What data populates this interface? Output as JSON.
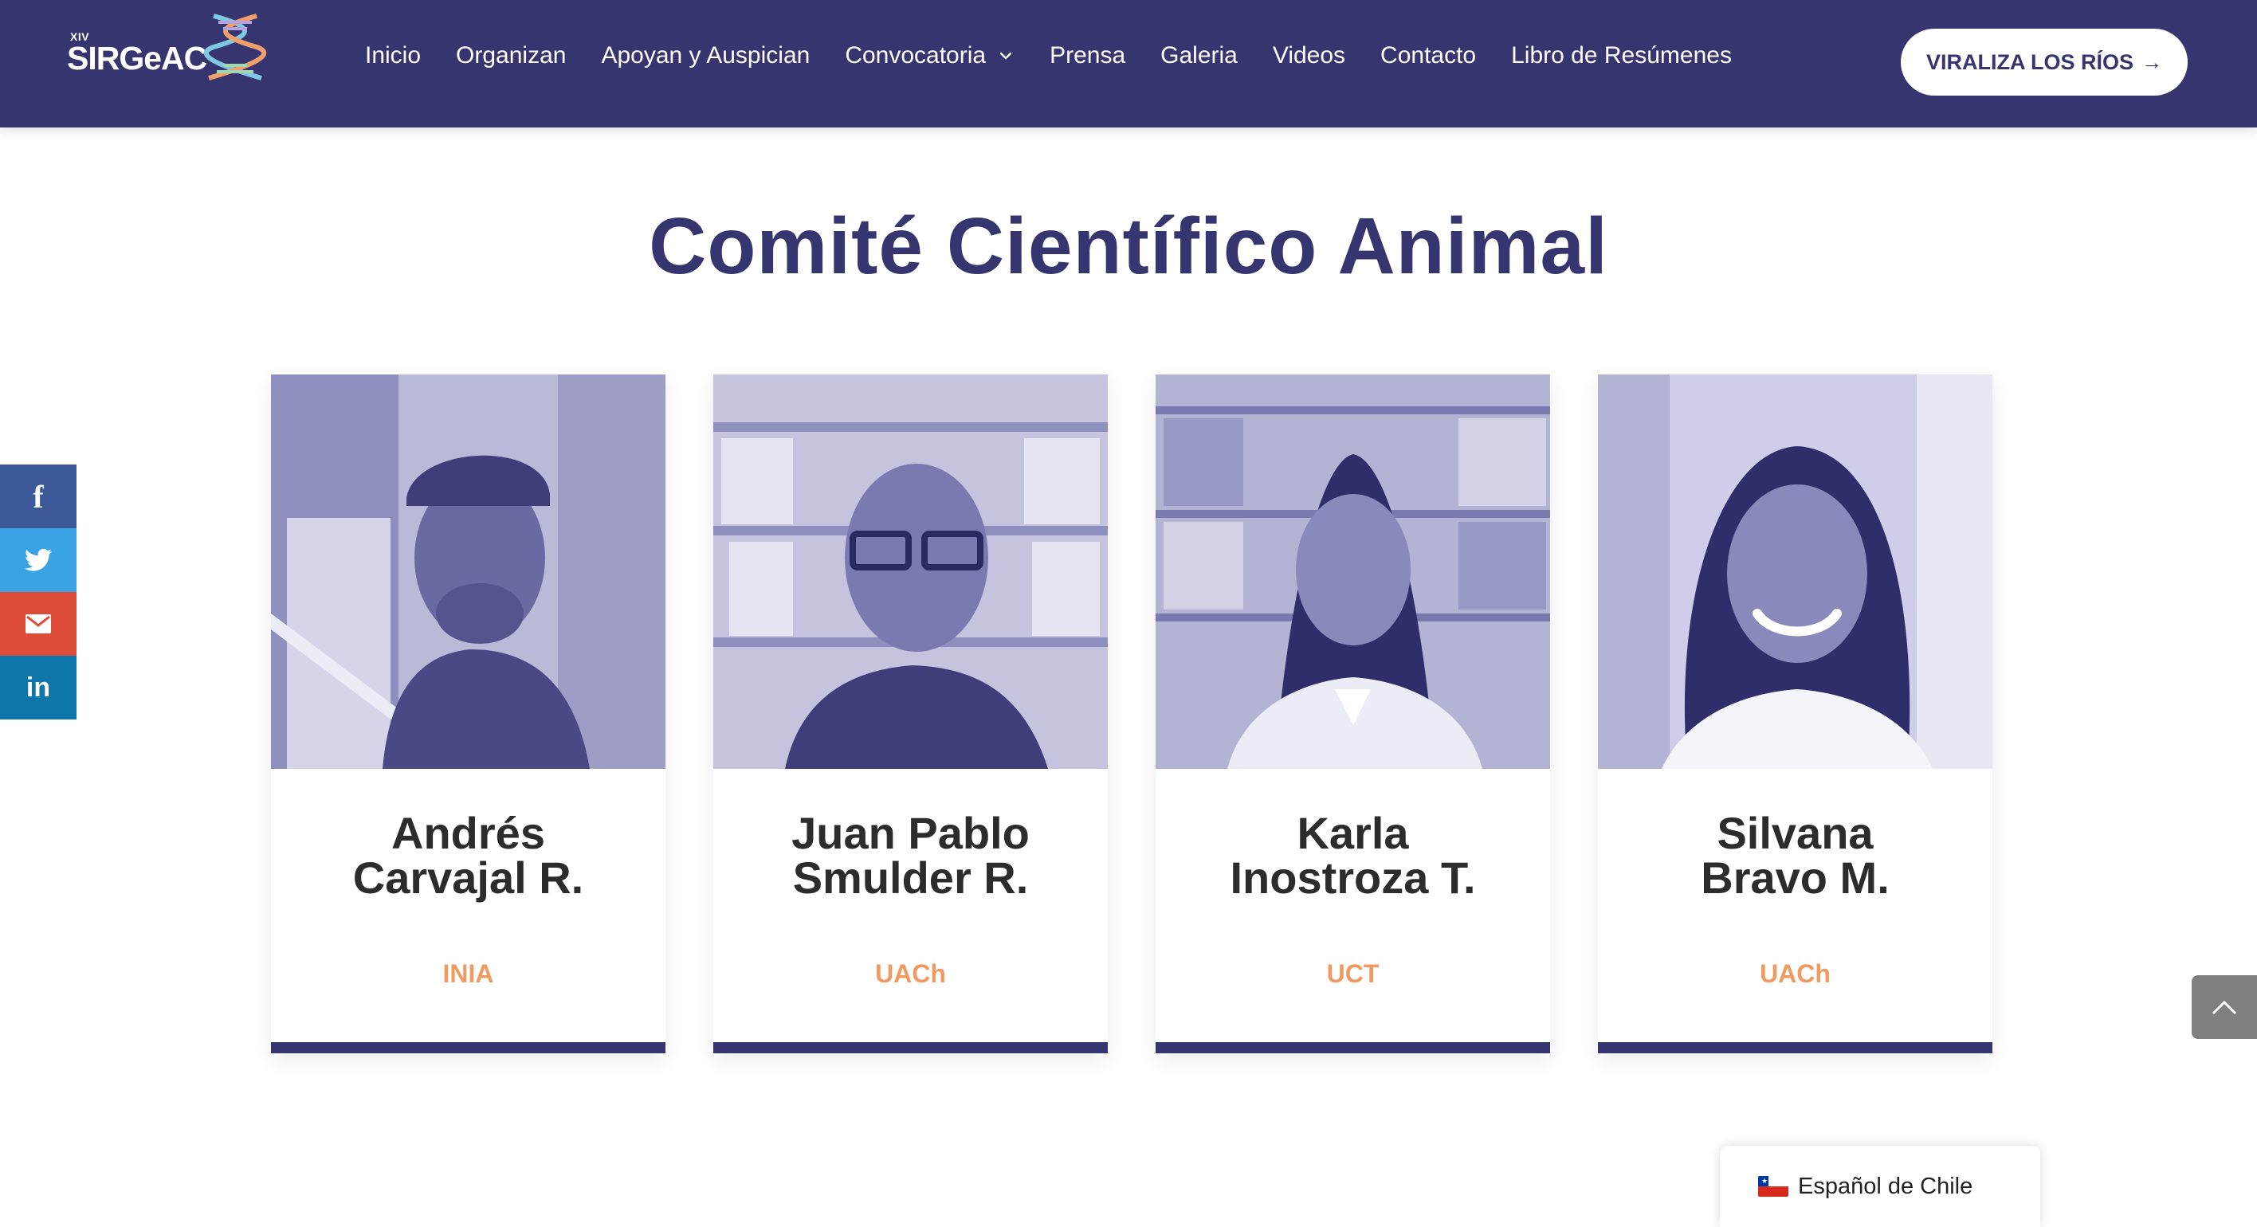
{
  "header": {
    "logo_edition": "XIV",
    "logo_name": "SIRGeAC",
    "nav": [
      {
        "label": "Inicio"
      },
      {
        "label": "Organizan"
      },
      {
        "label": "Apoyan y Auspician"
      },
      {
        "label": "Convocatoria"
      },
      {
        "label": "Prensa"
      },
      {
        "label": "Galeria"
      },
      {
        "label": "Videos"
      },
      {
        "label": "Contacto"
      },
      {
        "label": "Libro de Resúmenes"
      }
    ],
    "cta_label": "VIRALIZA LOS RÍOS"
  },
  "main": {
    "title": "Comité Científico Animal",
    "members": [
      {
        "name_line1": "Andrés",
        "name_line2": "Carvajal R.",
        "institution": "INIA"
      },
      {
        "name_line1": "Juan Pablo",
        "name_line2": "Smulder R.",
        "institution": "UACh"
      },
      {
        "name_line1": "Karla",
        "name_line2": "Inostroza T.",
        "institution": "UCT"
      },
      {
        "name_line1": "Silvana",
        "name_line2": "Bravo M.",
        "institution": "UACh"
      }
    ]
  },
  "social": [
    "facebook-icon",
    "twitter-icon",
    "email-icon",
    "linkedin-icon"
  ],
  "language": {
    "label": "Español de Chile"
  },
  "colors": {
    "primary": "#363570",
    "accent": "#ef9a63",
    "white": "#ffffff"
  }
}
